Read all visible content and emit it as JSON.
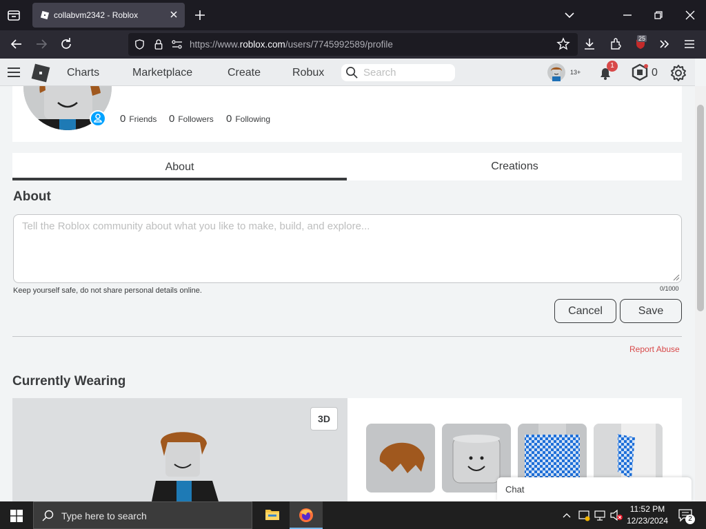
{
  "browser": {
    "tab_title": "collabvm2342 - Roblox",
    "url_prefix": "https://www.",
    "url_domain": "roblox.com",
    "url_path": "/users/7745992589/profile",
    "ext_badge": "25"
  },
  "header": {
    "nav": [
      "Charts",
      "Marketplace",
      "Create",
      "Robux"
    ],
    "search_placeholder": "Search",
    "age_label": "13+",
    "notifications_count": "1",
    "robux_balance": "0"
  },
  "profile": {
    "stats": [
      {
        "value": "0",
        "label": "Friends"
      },
      {
        "value": "0",
        "label": "Followers"
      },
      {
        "value": "0",
        "label": "Following"
      }
    ]
  },
  "tabs": [
    "About",
    "Creations"
  ],
  "about": {
    "heading": "About",
    "placeholder": "Tell the Roblox community about what you like to make, build, and explore...",
    "safety_note": "Keep yourself safe, do not share personal details online.",
    "char_count": "0/1000",
    "cancel_label": "Cancel",
    "save_label": "Save",
    "report_label": "Report Abuse"
  },
  "wearing": {
    "heading": "Currently Wearing",
    "toggle_3d": "3D"
  },
  "chat": {
    "label": "Chat"
  },
  "taskbar": {
    "search_placeholder": "Type here to search",
    "time": "11:52 PM",
    "date": "12/23/2024",
    "notification_count": "2"
  },
  "colors": {
    "link_red": "#d84949",
    "text_dark": "#393b3d",
    "presence_blue": "#00a2ff"
  }
}
